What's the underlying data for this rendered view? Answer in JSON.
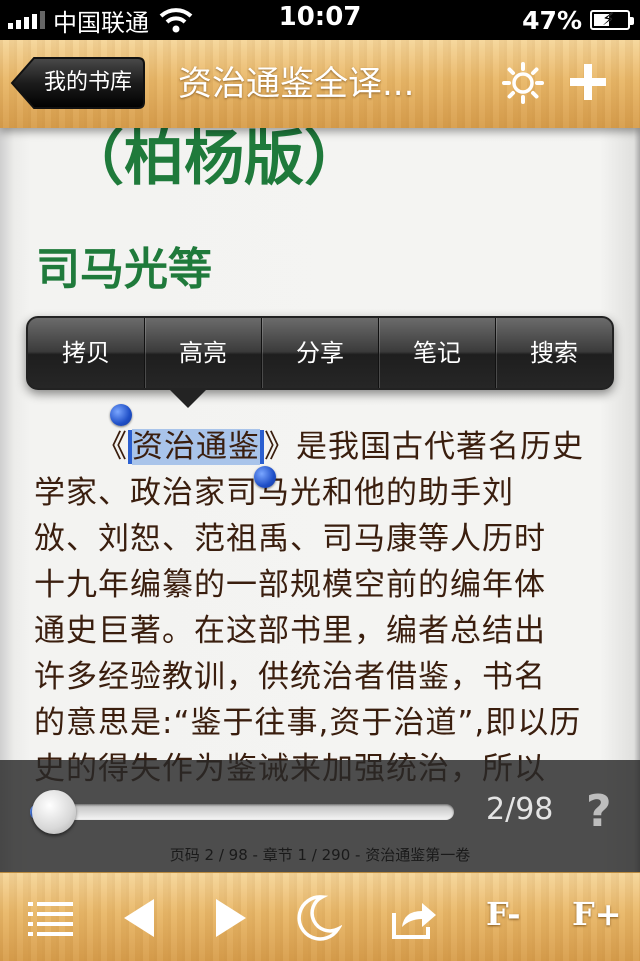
{
  "status_bar": {
    "carrier": "中国联通",
    "time": "10:07",
    "battery_percent": "47%",
    "battery_level": 0.47
  },
  "navbar": {
    "back_label": "我的书库",
    "title": "资治通鉴全译...",
    "icons": [
      "sun-icon",
      "plus-icon"
    ]
  },
  "content": {
    "heading1": "（柏杨版）",
    "heading2": "司马光等",
    "body_lines": [
      "学家、政治家司马光和他的助手刘",
      "攽、刘恕、范祖禹、司马康等人历时",
      "十九年编纂的一部规模空前的编年体",
      "通史巨著。在这部书里，编者总结出",
      "许多经验教训，供统治者借鉴，书名",
      "的意思是:“鉴于往事,资于治道”,即以历",
      "史的得失作为鉴诫来加强统治，所以"
    ],
    "first_line": {
      "open_quote": "《",
      "selected": "资治通鉴",
      "rest": "》是我国古代著名历史"
    }
  },
  "popup_menu": {
    "items": [
      "拷贝",
      "高亮",
      "分享",
      "笔记",
      "搜索"
    ]
  },
  "progress": {
    "value": 0.02,
    "page_display": "2/98",
    "help_label": "?",
    "footer": "页码 2 / 98 - 章节 1 / 290 - 资治通鉴第一卷"
  },
  "toolbar": {
    "icons": [
      "list-icon",
      "prev-icon",
      "next-icon",
      "moon-icon",
      "share-icon"
    ],
    "font_decrease_label": "F-",
    "font_increase_label": "F+"
  },
  "colors": {
    "heading_green": "#1f7a3b",
    "body_text": "#3a1e0e",
    "selection": "#a9c4ea",
    "wood_light": "#f6d69a",
    "wood_dark": "#d89e4c"
  }
}
